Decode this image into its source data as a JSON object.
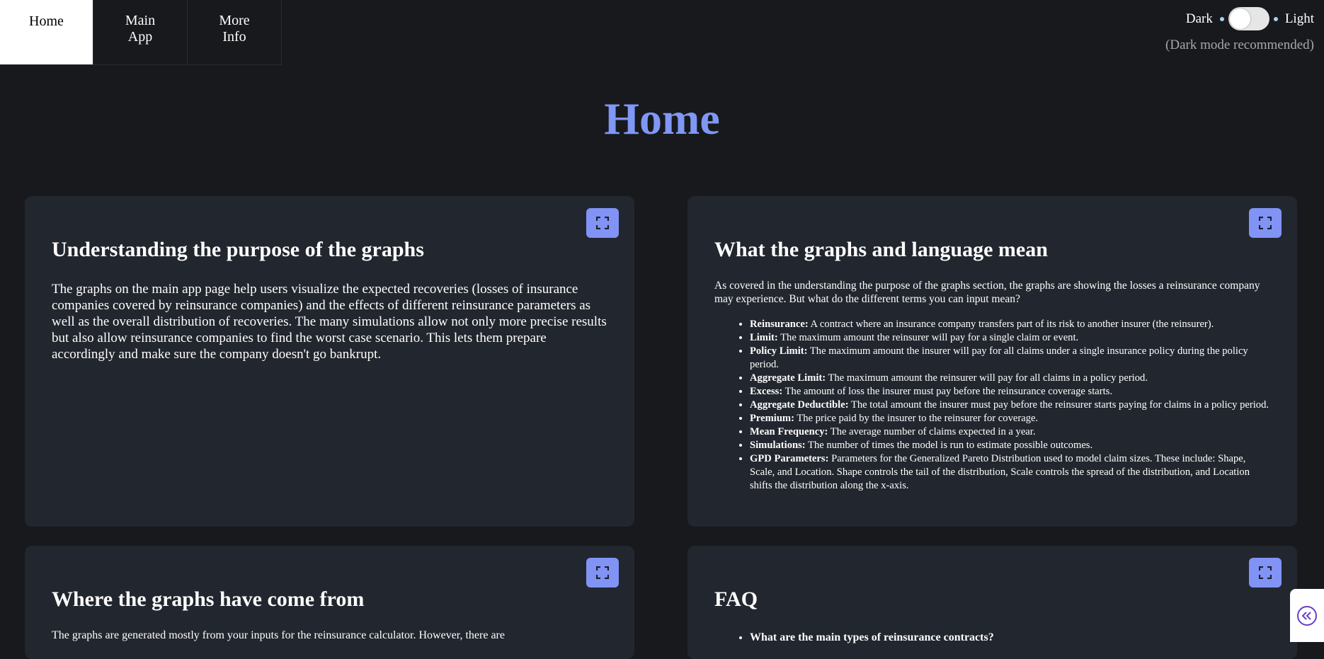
{
  "nav": {
    "items": [
      {
        "label": "Home",
        "active": true
      },
      {
        "label": "Main\nApp",
        "active": false
      },
      {
        "label": "More\nInfo",
        "active": false
      }
    ]
  },
  "theme": {
    "dark_label": "Dark",
    "light_label": "Light",
    "recommendation": "(Dark mode recommended)"
  },
  "page_title": "Home",
  "cards": {
    "purpose": {
      "title": "Understanding the purpose of the graphs",
      "body": "The graphs on the main app page help users visualize the expected recoveries (losses of insurance companies covered by reinsurance companies) and the effects of different reinsurance parameters as well as the overall distribution of recoveries. The many simulations allow not only more precise results but also allow reinsurance companies to find the worst case scenario. This lets them prepare accordingly and make sure the company doesn't go bankrupt."
    },
    "meaning": {
      "title": "What the graphs and language mean",
      "intro": "As covered in the understanding the purpose of the graphs section, the graphs are showing the losses a reinsurance company may experience. But what do the different terms you can input mean?",
      "terms": [
        {
          "term": "Reinsurance:",
          "def": " A contract where an insurance company transfers part of its risk to another insurer (the reinsurer)."
        },
        {
          "term": "Limit:",
          "def": " The maximum amount the reinsurer will pay for a single claim or event."
        },
        {
          "term": "Policy Limit:",
          "def": " The maximum amount the insurer will pay for all claims under a single insurance policy during the policy period."
        },
        {
          "term": "Aggregate Limit:",
          "def": " The maximum amount the reinsurer will pay for all claims in a policy period."
        },
        {
          "term": "Excess:",
          "def": " The amount of loss the insurer must pay before the reinsurance coverage starts."
        },
        {
          "term": "Aggregate Deductible:",
          "def": " The total amount the insurer must pay before the reinsurer starts paying for claims in a policy period."
        },
        {
          "term": "Premium:",
          "def": " The price paid by the insurer to the reinsurer for coverage."
        },
        {
          "term": "Mean Frequency:",
          "def": " The average number of claims expected in a year."
        },
        {
          "term": "Simulations:",
          "def": " The number of times the model is run to estimate possible outcomes."
        },
        {
          "term": "GPD Parameters:",
          "def": " Parameters for the Generalized Pareto Distribution used to model claim sizes. These include: Shape, Scale, and Location. Shape controls the tail of the distribution, Scale controls the spread of the distribution, and Location shifts the distribution along the x-axis."
        }
      ]
    },
    "origin": {
      "title": "Where the graphs have come from",
      "body": "The graphs are generated mostly from your inputs for the reinsurance calculator. However, there are"
    },
    "faq": {
      "title": "FAQ",
      "items": [
        "What are the main types of reinsurance contracts?"
      ]
    }
  },
  "icons": {
    "expand": "expand-icon",
    "collapse_sidebar": "double-chevron-left-icon"
  },
  "colors": {
    "background": "#18191c",
    "card": "#22262e",
    "accent": "#7f97f5",
    "button": "#8193f5",
    "side_icon": "#6a3fc4"
  }
}
